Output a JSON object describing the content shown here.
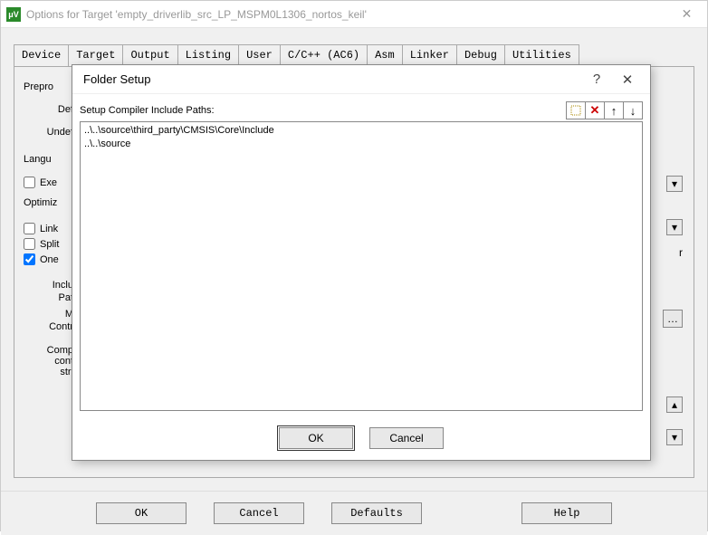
{
  "window": {
    "title": "Options for Target 'empty_driverlib_src_LP_MSPM0L1306_nortos_keil'",
    "icon_text": "μV"
  },
  "tabs": {
    "items": [
      {
        "label": "Device"
      },
      {
        "label": "Target"
      },
      {
        "label": "Output"
      },
      {
        "label": "Listing"
      },
      {
        "label": "User"
      },
      {
        "label": "C/C++ (AC6)",
        "active": true
      },
      {
        "label": "Asm"
      },
      {
        "label": "Linker"
      },
      {
        "label": "Debug"
      },
      {
        "label": "Utilities"
      }
    ]
  },
  "left_labels": {
    "prepro": "Prepro",
    "def": "Def",
    "undef": "Undef",
    "langu": "Langu",
    "exe": "Exe",
    "optim": "Optimiz",
    "link": "Link",
    "split": "Split",
    "one": "One",
    "inclu": "Inclu",
    "pat": "Pat",
    "m": "M",
    "contr": "Contr",
    "comp": "Comp",
    "cont": "cont",
    "stri": "stri"
  },
  "right_flag": "r",
  "main_buttons": {
    "ok": "OK",
    "cancel": "Cancel",
    "defaults": "Defaults",
    "help": "Help"
  },
  "modal": {
    "title": "Folder Setup",
    "setup_label": "Setup Compiler Include Paths:",
    "paths": [
      "..\\..\\source\\third_party\\CMSIS\\Core\\Include",
      "..\\..\\source"
    ],
    "toolbar": {
      "new": "new-icon",
      "delete": "✕",
      "up": "↑",
      "down": "↓"
    },
    "ok": "OK",
    "cancel": "Cancel"
  }
}
